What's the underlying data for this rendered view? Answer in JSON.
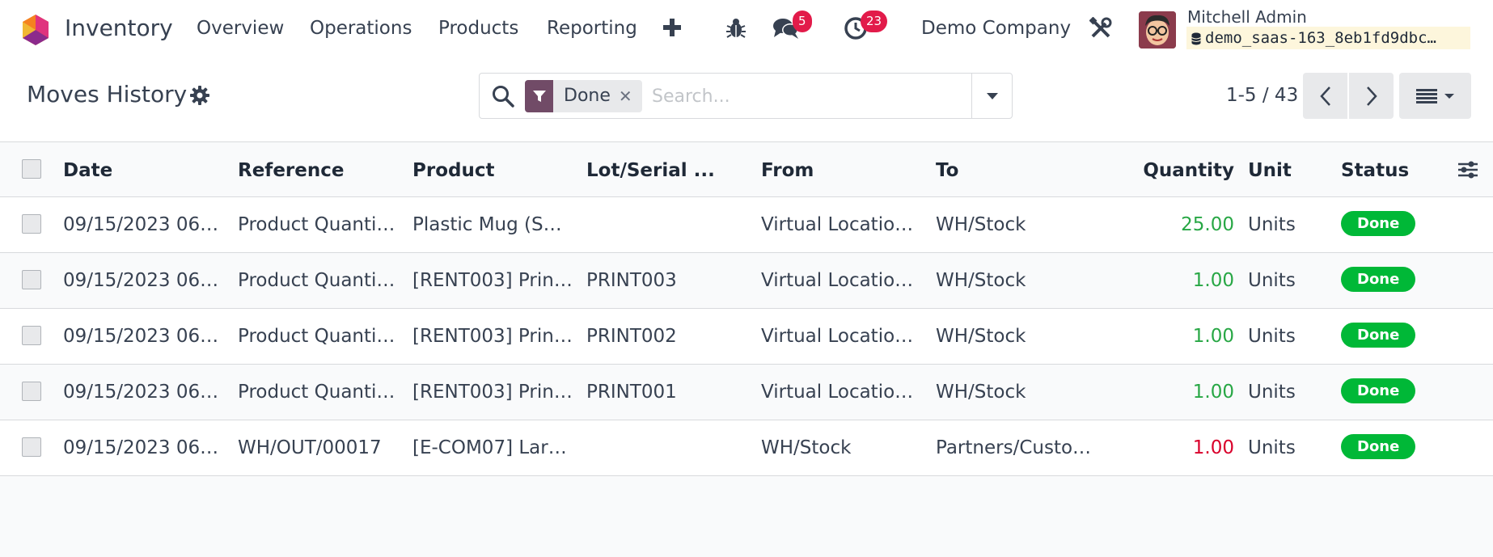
{
  "navbar": {
    "app_name": "Inventory",
    "menus": [
      "Overview",
      "Operations",
      "Products",
      "Reporting"
    ],
    "messages_count": "5",
    "activities_count": "23",
    "company": "Demo Company",
    "user_name": "Mitchell Admin",
    "database": "demo_saas-163_8eb1fd9dbc…"
  },
  "control_panel": {
    "title": "Moves History",
    "search": {
      "facet": "Done",
      "placeholder": "Search..."
    },
    "pager": "1-5 / 43"
  },
  "list": {
    "columns": [
      "Date",
      "Reference",
      "Product",
      "Lot/Serial ...",
      "From",
      "To",
      "Quantity",
      "Unit",
      "Status"
    ],
    "rows": [
      {
        "date": "09/15/2023 06:…",
        "reference": "Product Quanti…",
        "product": "Plastic Mug (SUB)",
        "lot": "",
        "from": "Virtual Locatio…",
        "to": "WH/Stock",
        "quantity": "25.00",
        "unit": "Units",
        "status": "Done"
      },
      {
        "date": "09/15/2023 06:…",
        "reference": "Product Quanti…",
        "product": "[RENT003] Prin…",
        "lot": "PRINT003",
        "from": "Virtual Locatio…",
        "to": "WH/Stock",
        "quantity": "1.00",
        "unit": "Units",
        "status": "Done"
      },
      {
        "date": "09/15/2023 06:…",
        "reference": "Product Quanti…",
        "product": "[RENT003] Prin…",
        "lot": "PRINT002",
        "from": "Virtual Locatio…",
        "to": "WH/Stock",
        "quantity": "1.00",
        "unit": "Units",
        "status": "Done"
      },
      {
        "date": "09/15/2023 06:…",
        "reference": "Product Quanti…",
        "product": "[RENT003] Prin…",
        "lot": "PRINT001",
        "from": "Virtual Locatio…",
        "to": "WH/Stock",
        "quantity": "1.00",
        "unit": "Units",
        "status": "Done"
      },
      {
        "date": "09/15/2023 06:…",
        "reference": "WH/OUT/00017",
        "product": "[E-COM07] Lar…",
        "lot": "",
        "from": "WH/Stock",
        "to": "Partners/Custo…",
        "quantity": "1.00",
        "unit": "Units",
        "status": "Done"
      }
    ]
  },
  "colors": {
    "brand": "#714b67",
    "badge": "#e21b4a",
    "status_done": "#00b837",
    "qty_in": "#28a745",
    "qty_out": "#d9002b"
  },
  "icons": [
    "app-logo-icon",
    "plus-icon",
    "bug-icon",
    "chat-icon",
    "clock-icon",
    "tools-icon",
    "database-icon",
    "gear-icon",
    "search-icon",
    "filter-icon",
    "close-icon",
    "caret-down-icon",
    "chevron-left-icon",
    "chevron-right-icon",
    "list-view-icon",
    "optional-columns-icon"
  ]
}
